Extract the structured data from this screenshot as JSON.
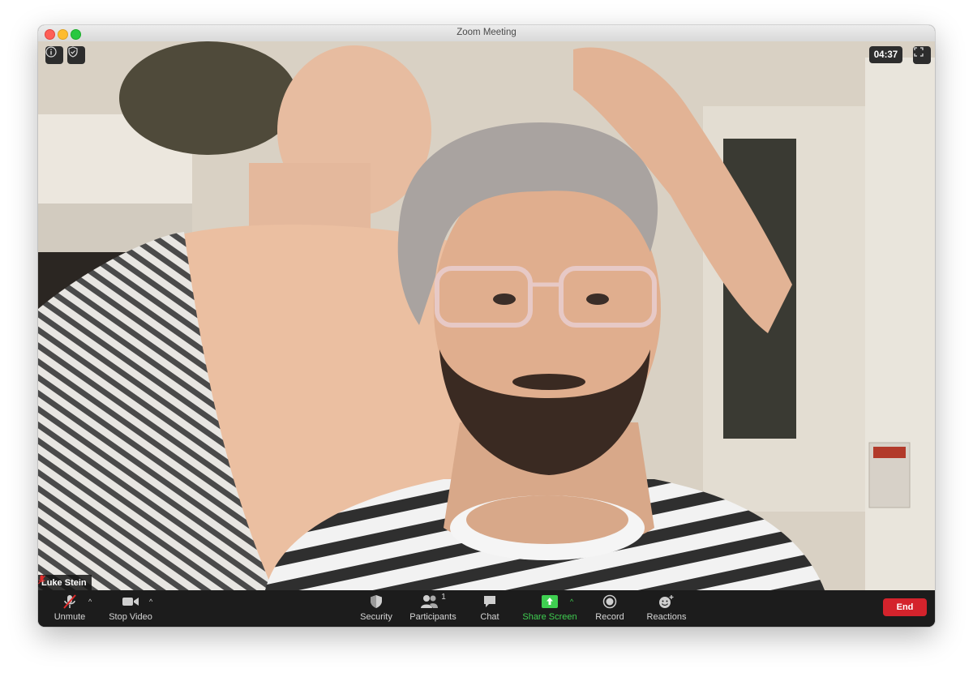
{
  "window": {
    "title": "Zoom Meeting"
  },
  "meeting": {
    "timer": "04:37"
  },
  "participant": {
    "name": "Luke Stein",
    "muted": true
  },
  "toolbar": {
    "unmute": "Unmute",
    "stop_video": "Stop Video",
    "security": "Security",
    "participants": "Participants",
    "participants_count": "1",
    "chat": "Chat",
    "share_screen": "Share Screen",
    "record": "Record",
    "reactions": "Reactions",
    "end": "End"
  },
  "colors": {
    "share_green": "#3fcf51",
    "end_red": "#d4232c",
    "muted_red": "#e02b2b"
  }
}
